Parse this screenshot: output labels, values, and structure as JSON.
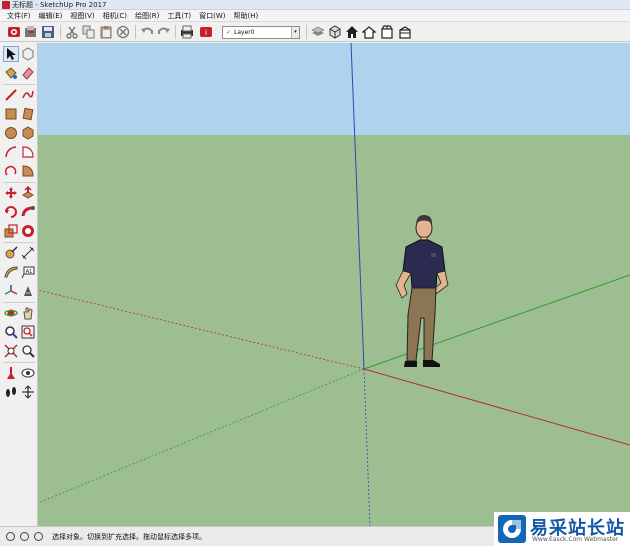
{
  "window": {
    "title": "无标题 - SketchUp Pro 2017"
  },
  "menu": {
    "items": [
      "文件(F)",
      "编辑(E)",
      "视图(V)",
      "相机(C)",
      "绘图(R)",
      "工具(T)",
      "窗口(W)",
      "帮助(H)"
    ]
  },
  "toolbar": {
    "layer_select": {
      "check": "✓",
      "value": "Layer0",
      "arrow": "▾"
    },
    "icons": [
      "warehouse-icon",
      "open-icon",
      "save-icon",
      "cut-icon",
      "copy-icon",
      "paste-icon",
      "erase-icon",
      "undo-icon",
      "redo-icon",
      "print-icon",
      "model-info-icon",
      "layer-manager-icon",
      "iso-view-icon",
      "top-view-icon",
      "front-view-icon",
      "right-view-icon",
      "back-view-icon",
      "left-view-icon"
    ]
  },
  "palette": {
    "tools": [
      "select-icon",
      "component-icon",
      "paint-bucket-icon",
      "eraser-icon",
      "line-icon",
      "freehand-icon",
      "rectangle-icon",
      "rotated-rectangle-icon",
      "circle-icon",
      "polygon-icon",
      "arc-icon",
      "pie-icon",
      "two-point-arc-icon",
      "three-point-arc-icon",
      "move-icon",
      "push-pull-icon",
      "rotate-icon",
      "follow-me-icon",
      "scale-icon",
      "offset-icon",
      "tape-measure-icon",
      "dimension-icon",
      "protractor-icon",
      "text-icon",
      "axes-icon",
      "3d-text-icon",
      "orbit-icon",
      "pan-icon",
      "zoom-icon",
      "zoom-window-icon",
      "zoom-extents-icon",
      "previous-view-icon",
      "position-camera-icon",
      "look-around-icon",
      "walk-icon",
      "section-plane-icon"
    ],
    "active_tool": "select-icon"
  },
  "viewport": {
    "sky_color": "#aed3ec",
    "ground_color": "#9dbe90",
    "axis_colors": {
      "blue": "#2a47b8",
      "green": "#2aa02a",
      "red": "#b03030"
    }
  },
  "status": {
    "text": "选择对象。切换到扩充选择。拖动鼠标选择多项。"
  },
  "watermark": {
    "title": "易采站长站",
    "subtitle": "Www.Easck.Com Webmaster"
  }
}
